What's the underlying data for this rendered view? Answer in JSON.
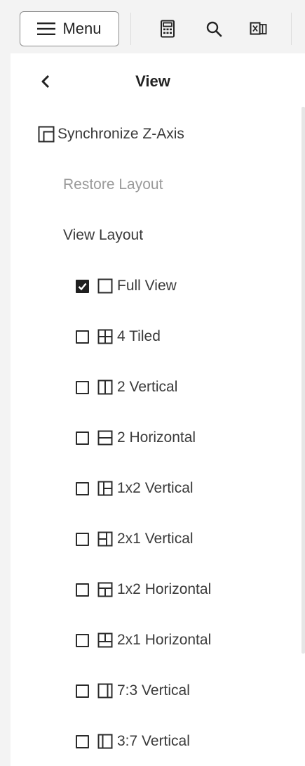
{
  "toolbar": {
    "menu_label": "Menu",
    "icons": [
      "calculator-icon",
      "search-icon",
      "excel-export-icon"
    ]
  },
  "panel": {
    "title": "View",
    "sync_label": "Synchronize Z-Axis",
    "restore_label": "Restore Layout",
    "section_label": "View Layout",
    "layouts": [
      {
        "label": "Full View",
        "icon": "full-view-icon",
        "checked": true
      },
      {
        "label": "4 Tiled",
        "icon": "four-tiled-icon",
        "checked": false
      },
      {
        "label": "2 Vertical",
        "icon": "two-vertical-icon",
        "checked": false
      },
      {
        "label": "2 Horizontal",
        "icon": "two-horizontal-icon",
        "checked": false
      },
      {
        "label": "1x2 Vertical",
        "icon": "one-by-two-vertical-icon",
        "checked": false
      },
      {
        "label": "2x1 Vertical",
        "icon": "two-by-one-vertical-icon",
        "checked": false
      },
      {
        "label": "1x2 Horizontal",
        "icon": "one-by-two-horizontal-icon",
        "checked": false
      },
      {
        "label": "2x1 Horizontal",
        "icon": "two-by-one-horizontal-icon",
        "checked": false
      },
      {
        "label": "7:3 Vertical",
        "icon": "seven-three-vertical-icon",
        "checked": false
      },
      {
        "label": "3:7 Vertical",
        "icon": "three-seven-vertical-icon",
        "checked": false
      }
    ]
  },
  "colors": {
    "background": "#f3f3f3",
    "panel": "#ffffff",
    "text": "#333333",
    "muted_text": "#9a9a9a",
    "checkbox_checked": "#1f1f1f"
  }
}
